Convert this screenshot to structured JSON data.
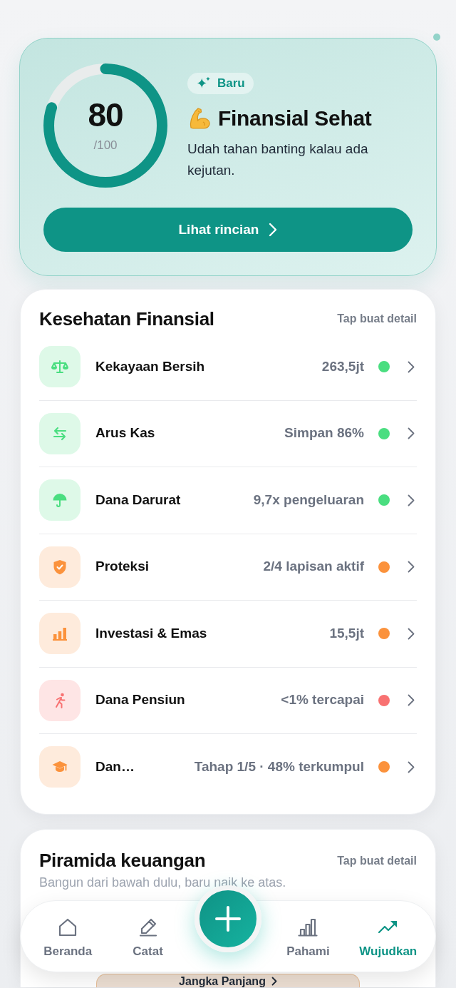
{
  "score_card": {
    "score": "80",
    "max": "/100",
    "level": 0.8,
    "badge": "Baru",
    "title": "Finansial Sehat",
    "description": "Udah tahan banting kalau ada kejutan.",
    "button": "Lihat rincian"
  },
  "health": {
    "title": "Kesehatan Finansial",
    "hint": "Tap buat detail",
    "items": [
      {
        "label": "Kekayaan Bersih",
        "value": "263,5jt",
        "color": "#4ade80"
      },
      {
        "label": "Arus Kas",
        "value": "Simpan 86%",
        "color": "#4ade80"
      },
      {
        "label": "Dana Darurat",
        "value": "9,7x pengeluaran",
        "color": "#4ade80"
      },
      {
        "label": "Proteksi",
        "value": "2/4 lapisan aktif",
        "color": "#fb923c"
      },
      {
        "label": "Investasi & Emas",
        "value": "15,5jt",
        "color": "#fb923c"
      },
      {
        "label": "Dana Pensiun",
        "value": "<1% tercapai",
        "color": "#f87171"
      },
      {
        "label": "Dan…",
        "value": "Tahap 1/5 · 48% terkumpul",
        "color": "#fb923c"
      }
    ]
  },
  "pyramid": {
    "title": "Piramida keuangan",
    "hint": "Tap buat detail",
    "subtitle": "Bangun dari bawah dulu, baru naik ke atas.",
    "level_button": "Jangka Panjang"
  },
  "tab_bar": {
    "tabs": [
      {
        "label": "Beranda",
        "selected": false
      },
      {
        "label": "Catat",
        "selected": false
      },
      {
        "label": "Pahami",
        "selected": false
      },
      {
        "label": "Wujudkan",
        "selected": true
      }
    ]
  }
}
